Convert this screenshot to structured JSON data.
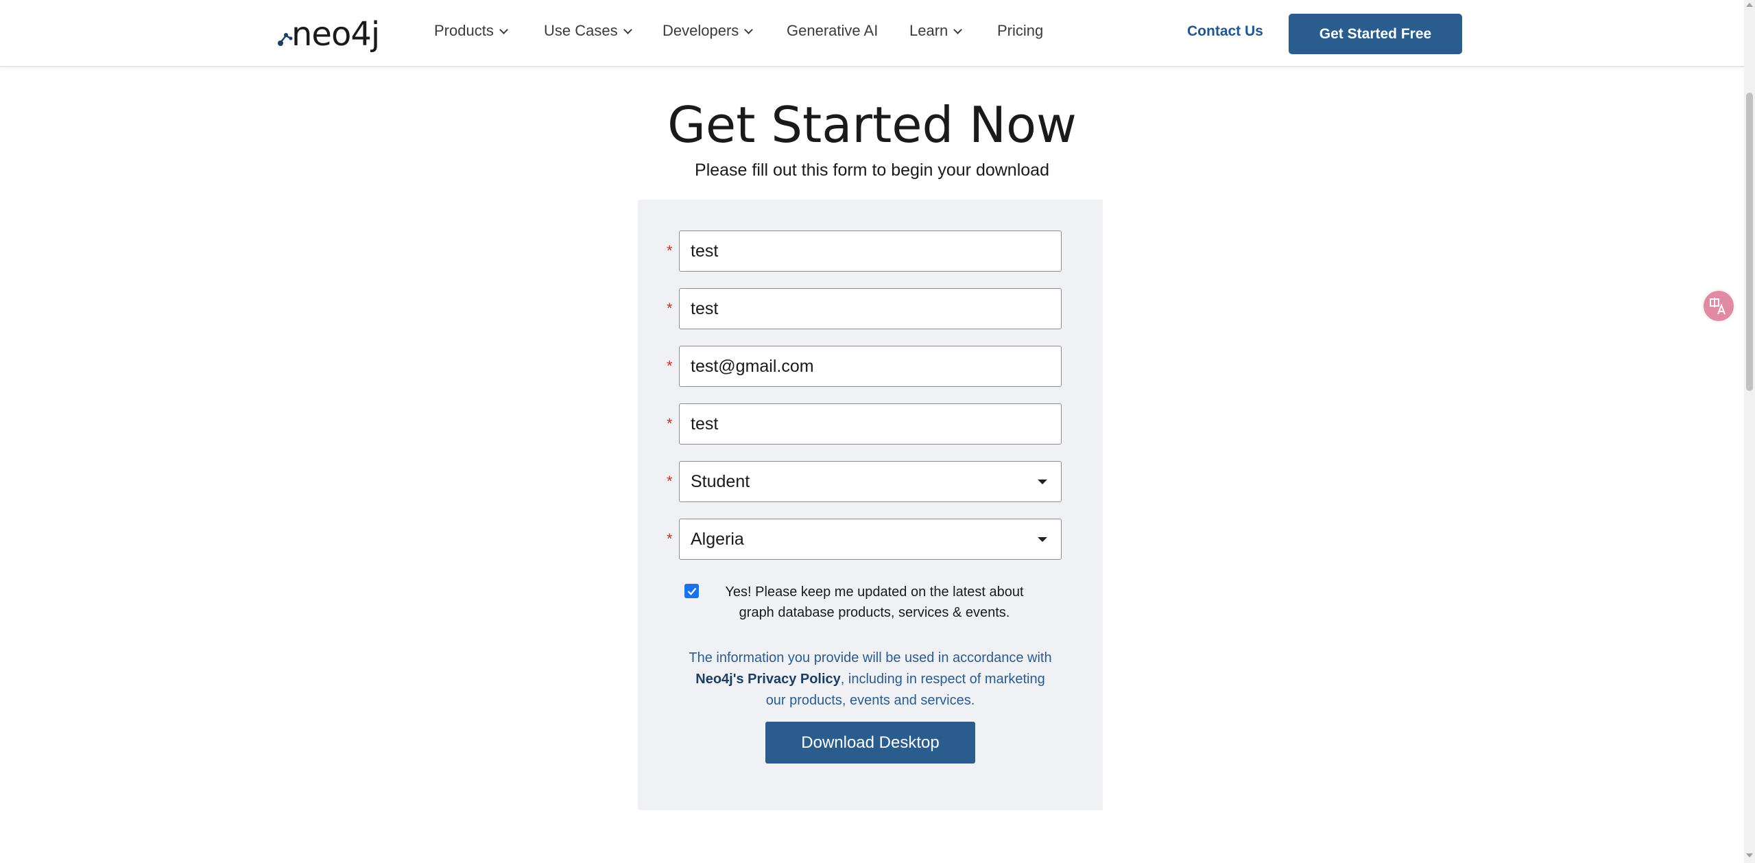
{
  "nav": {
    "logo_text": "neo4j",
    "items": [
      {
        "label": "Products",
        "dropdown": true
      },
      {
        "label": "Use Cases",
        "dropdown": true
      },
      {
        "label": "Developers",
        "dropdown": true
      },
      {
        "label": "Generative AI",
        "dropdown": false
      },
      {
        "label": "Learn",
        "dropdown": true
      },
      {
        "label": "Pricing",
        "dropdown": false
      }
    ],
    "contact_label": "Contact Us",
    "cta_label": "Get Started Free"
  },
  "hero": {
    "title": "Get Started Now",
    "subtitle": "Please fill out this form to begin your download"
  },
  "form": {
    "required_marker": "*",
    "fields": [
      {
        "value": "test"
      },
      {
        "value": "test"
      },
      {
        "value": "test@gmail.com"
      },
      {
        "value": "test"
      },
      {
        "value": "Student"
      },
      {
        "value": "Algeria"
      }
    ],
    "optin_checked": true,
    "optin_text": "Yes! Please keep me updated on the latest about graph database products, services & events.",
    "privacy_pre": "The information you provide will be used in accordance with ",
    "privacy_link": "Neo4j's Privacy Policy",
    "privacy_post": ", including in respect of marketing our products, events and services.",
    "submit_label": "Download Desktop"
  },
  "colors": {
    "brand_blue": "#2b5c8e",
    "panel_bg": "#eff1f5",
    "required_red": "#c0392b"
  }
}
